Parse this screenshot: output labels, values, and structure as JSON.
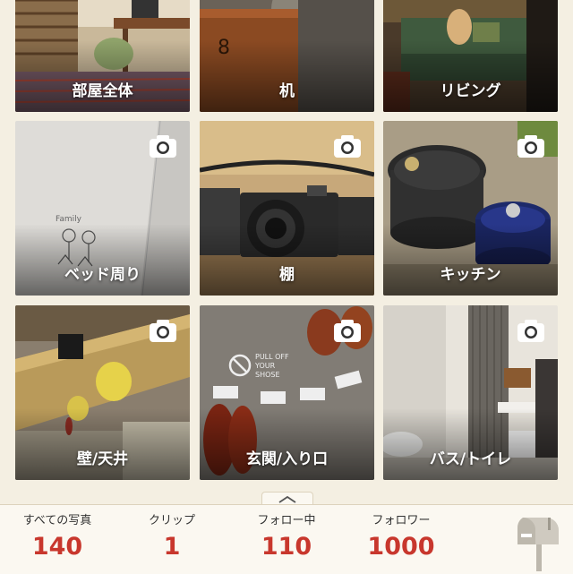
{
  "tiles": [
    {
      "label": "部屋全体",
      "camera": false
    },
    {
      "label": "机",
      "camera": false
    },
    {
      "label": "リビング",
      "camera": false
    },
    {
      "label": "ベッド周り",
      "camera": true
    },
    {
      "label": "棚",
      "camera": true
    },
    {
      "label": "キッチン",
      "camera": true
    },
    {
      "label": "壁/天井",
      "camera": true
    },
    {
      "label": "玄関/入り口",
      "camera": true
    },
    {
      "label": "バス/トイレ",
      "camera": true
    }
  ],
  "stats": {
    "all_photos": {
      "label": "すべての写真",
      "value": "140"
    },
    "clips": {
      "label": "クリップ",
      "value": "1"
    },
    "following": {
      "label": "フォロー中",
      "value": "110"
    },
    "followers": {
      "label": "フォロワー",
      "value": "1000"
    }
  },
  "icons": {
    "camera": "camera-icon",
    "mailbox": "mailbox-icon",
    "expand": "chevron-up-icon"
  },
  "colors": {
    "accent": "#c8372d",
    "background": "#f4efe2"
  }
}
